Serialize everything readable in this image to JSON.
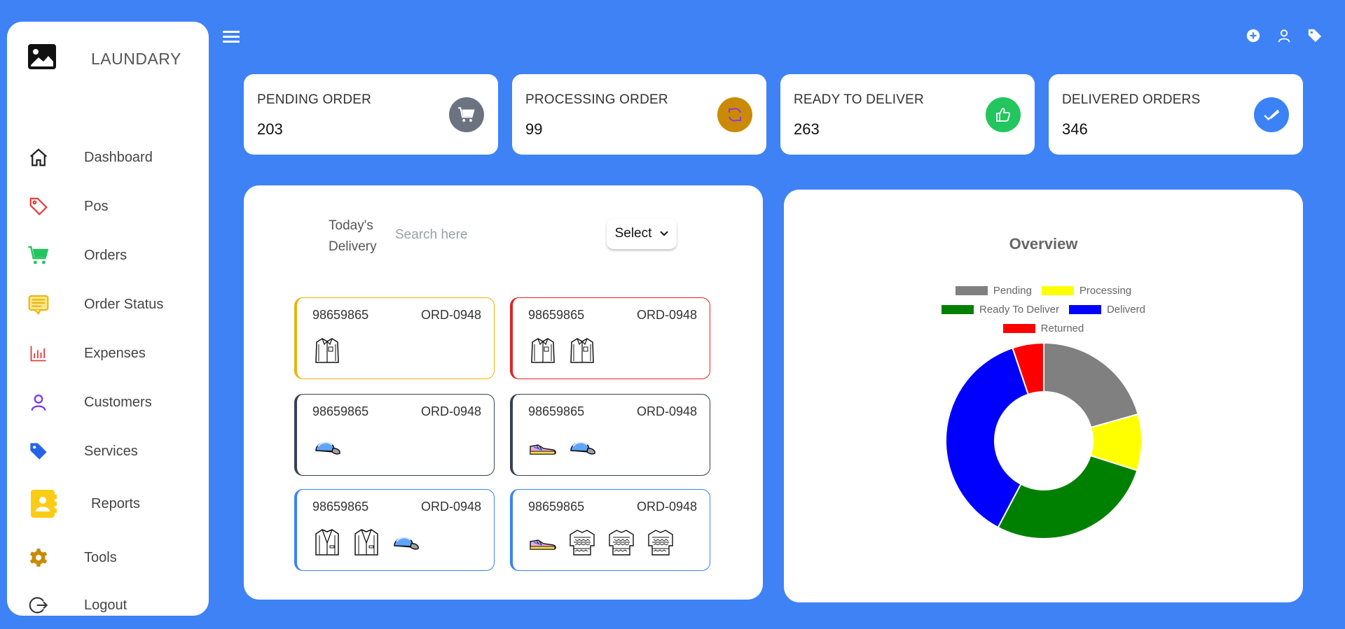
{
  "brand": {
    "title": "LAUNDARY"
  },
  "sidebar": {
    "items": [
      {
        "label": "Dashboard",
        "icon": "home-icon",
        "color": "#222222"
      },
      {
        "label": "Pos",
        "icon": "tag-icon",
        "color": "#e53e3e"
      },
      {
        "label": "Orders",
        "icon": "cart-icon",
        "color": "#22c55e"
      },
      {
        "label": "Order Status",
        "icon": "list-icon",
        "color": "#eab308"
      },
      {
        "label": "Expenses",
        "icon": "bar-chart-icon",
        "color": "#e53e3e"
      },
      {
        "label": "Customers",
        "icon": "user-icon",
        "color": "#7c3aed"
      },
      {
        "label": "Services",
        "icon": "tag-filled-icon",
        "color": "#2563eb"
      },
      {
        "label": "Reports",
        "icon": "contact-book-icon",
        "color": "#facc15"
      },
      {
        "label": "Tools",
        "icon": "gear-icon",
        "color": "#ca8a04"
      },
      {
        "label": "Logout",
        "icon": "logout-icon",
        "color": "#333333"
      }
    ]
  },
  "topbar": {
    "icons": [
      "plus-circle-icon",
      "user-icon",
      "tag-icon"
    ]
  },
  "stats": [
    {
      "title": "PENDING ORDER",
      "value": "203",
      "icon": "cart-icon",
      "color": "#6b7280"
    },
    {
      "title": "PROCESSING ORDER",
      "value": "99",
      "icon": "refresh-icon",
      "color": "#ca8a04"
    },
    {
      "title": "READY TO DELIVER",
      "value": "263",
      "icon": "thumbs-up-icon",
      "color": "#22c55e"
    },
    {
      "title": "DELIVERED ORDERS",
      "value": "346",
      "icon": "check-icon",
      "color": "#3b82f6"
    }
  ],
  "delivery": {
    "label": "Today's Delivery",
    "search_placeholder": "Search here",
    "select_label": "Select",
    "orders": [
      {
        "phone": "98659865",
        "id": "ORD-0948",
        "border": "#eab308",
        "items": [
          "shirt-icon"
        ]
      },
      {
        "phone": "98659865",
        "id": "ORD-0948",
        "border": "#dc2626",
        "items": [
          "shirt-icon",
          "shirt-icon"
        ]
      },
      {
        "phone": "98659865",
        "id": "ORD-0948",
        "border": "#374151",
        "items": [
          "cap-icon"
        ]
      },
      {
        "phone": "98659865",
        "id": "ORD-0948",
        "border": "#374151",
        "items": [
          "shoe-icon",
          "cap-icon"
        ]
      },
      {
        "phone": "98659865",
        "id": "ORD-0948",
        "border": "#3b82f6",
        "items": [
          "jacket-icon",
          "jacket-icon",
          "cap-icon"
        ]
      },
      {
        "phone": "98659865",
        "id": "ORD-0948",
        "border": "#3b82f6",
        "items": [
          "shoe-icon",
          "sweater-icon",
          "sweater-icon",
          "sweater-icon"
        ]
      }
    ]
  },
  "overview": {
    "title": "Overview",
    "chart_data": {
      "type": "pie",
      "series": [
        {
          "name": "Pending",
          "value": 20,
          "color": "#808080"
        },
        {
          "name": "Processing",
          "value": 9,
          "color": "#ffff00"
        },
        {
          "name": "Ready To Deliver",
          "value": 27,
          "color": "#008000"
        },
        {
          "name": "Deliverd",
          "value": 36,
          "color": "#0000ff"
        },
        {
          "name": "Returned",
          "value": 5,
          "color": "#ff0000"
        }
      ],
      "legend": "top"
    }
  }
}
